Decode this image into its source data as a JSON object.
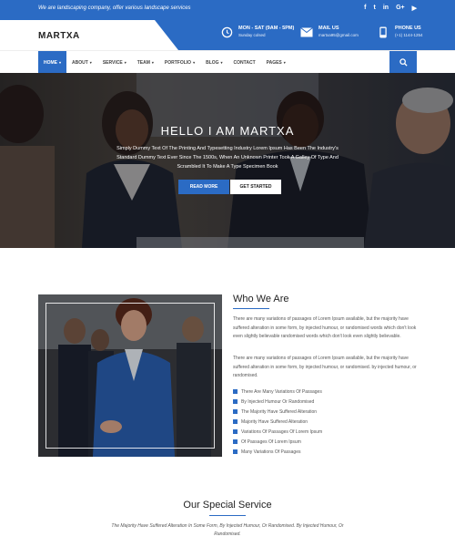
{
  "topbar": {
    "tagline": "We are landscaping company, offer various landscape services",
    "socials": [
      "f",
      "t",
      "in",
      "G+",
      "▶"
    ]
  },
  "header": {
    "logo": "MARTXA",
    "hours_title": "MON - SAT (9AM - 5PM)",
    "hours_sub": "Sunday colsed",
    "mail_title": "MAIL US",
    "mail_sub": "martxa95@gmail.com",
    "phone_title": "PHONE US",
    "phone_sub": "(+1) 1144-1254"
  },
  "nav": {
    "items": [
      {
        "label": "HOME",
        "caret": true
      },
      {
        "label": "ABOUT",
        "caret": true
      },
      {
        "label": "SERVICE",
        "caret": true
      },
      {
        "label": "TEAM",
        "caret": true
      },
      {
        "label": "PORTFOLIO",
        "caret": true
      },
      {
        "label": "BLOG",
        "caret": true
      },
      {
        "label": "CONTACT",
        "caret": false
      },
      {
        "label": "PAGES",
        "caret": true
      }
    ]
  },
  "hero": {
    "title": "HELLO I AM MARTXA",
    "text": "Simply Dummy Text Of The Printing And Typesetting Industry Lorem Ipsum Has Been The Industry's Standard Dummy Text Ever Since The 1500s, When An Unknown Printer Took A Galley Of Type And Scrambled It To Make A Type Specimen Book",
    "read_more": "READ MORE",
    "get_started": "GET STARTED"
  },
  "who": {
    "title": "Who We Are",
    "para1": "There are many variations of passages of Lorem Ipsum available, but the majority have suffered alteration in some form, by injected humour, or randomised words which don't look even slightly believable randomised words which don't look even slightly believable.",
    "para2": "There are many variations of passages of Lorem Ipsum available, but the majority have suffered alteration in some form, by injected humour, or randomised. by injected humour, or randomised.",
    "list": [
      "There Are Many Variations Of Passages",
      "By Injected Humour Or Randomised",
      "The Majority Have Suffered Alteration",
      "Majority Have Suffered Alteration",
      "Variations Of Passages Of Lorem Ipsum",
      "Of Passages Of Lorem Ipsum",
      "Many Variations Of Passages"
    ]
  },
  "service": {
    "title": "Our Special Service",
    "text": "The Majority Have Suffered Alteration In Some Form, By Injected Humour, Or Randomised. By Injected Humour, Or Randomised."
  },
  "colors": {
    "accent": "#2b6bc4"
  }
}
